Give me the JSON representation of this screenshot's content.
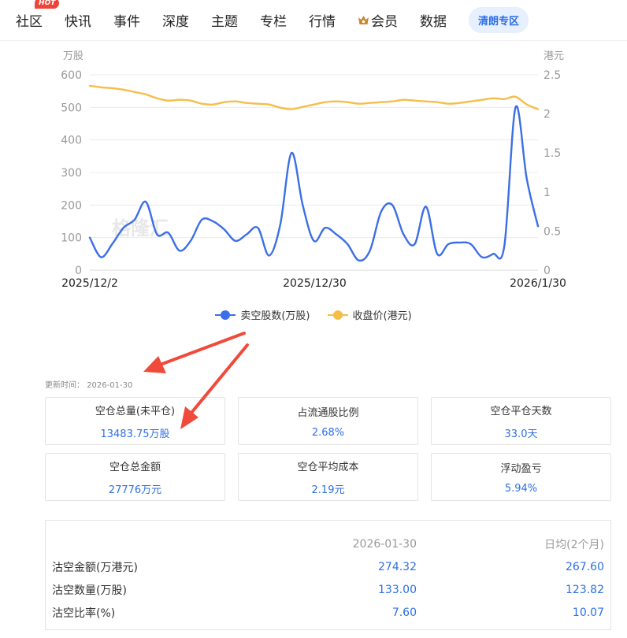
{
  "nav": {
    "items": [
      "社区",
      "快讯",
      "事件",
      "深度",
      "主题",
      "专栏",
      "行情",
      "会员",
      "数据"
    ],
    "hot_badge": "HOT",
    "special": "清朗专区"
  },
  "watermark": "格隆汇",
  "colors": {
    "short_volume": "#3b6fe6",
    "close_price": "#f5be4b",
    "value_blue": "#2d6fe5"
  },
  "legend": [
    "卖空股数(万股)",
    "收盘价(港元)"
  ],
  "chart_data": {
    "type": "line",
    "x_tick_labels": [
      "2025/12/2",
      "2025/12/30",
      "2026/1/30"
    ],
    "y_left": {
      "label": "万股",
      "range": [
        0,
        600
      ],
      "ticks": [
        0,
        100,
        200,
        300,
        400,
        500,
        600
      ]
    },
    "y_right": {
      "label": "港元",
      "range": [
        0,
        2.5
      ],
      "ticks": [
        0,
        0.5,
        1,
        1.5,
        2,
        2.5
      ]
    },
    "grid": true,
    "legend_position": "bottom",
    "series": [
      {
        "name": "卖空股数(万股)",
        "axis": "left",
        "values": [
          100,
          40,
          80,
          130,
          155,
          210,
          110,
          115,
          60,
          90,
          155,
          150,
          125,
          90,
          110,
          130,
          45,
          140,
          360,
          200,
          90,
          130,
          110,
          80,
          30,
          60,
          180,
          200,
          110,
          80,
          195,
          50,
          80,
          85,
          80,
          40,
          50,
          75,
          500,
          280,
          135
        ]
      },
      {
        "name": "收盘价(港元)",
        "axis": "right",
        "values": [
          2.36,
          2.34,
          2.33,
          2.31,
          2.28,
          2.25,
          2.2,
          2.17,
          2.18,
          2.17,
          2.13,
          2.12,
          2.15,
          2.16,
          2.14,
          2.13,
          2.12,
          2.08,
          2.06,
          2.09,
          2.12,
          2.15,
          2.16,
          2.15,
          2.13,
          2.14,
          2.15,
          2.16,
          2.18,
          2.17,
          2.16,
          2.15,
          2.13,
          2.14,
          2.16,
          2.18,
          2.2,
          2.19,
          2.22,
          2.12,
          2.06
        ]
      }
    ]
  },
  "update": {
    "label": "更新时间：",
    "value": "2026-01-30"
  },
  "cards": [
    {
      "label": "空仓总量(未平仓)",
      "value": "13483.75万股"
    },
    {
      "label": "占流通股比例",
      "value": "2.68%"
    },
    {
      "label": "空仓平仓天数",
      "value": "33.0天"
    },
    {
      "label": "空仓总金额",
      "value": "27776万元"
    },
    {
      "label": "空仓平均成本",
      "value": "2.19元"
    },
    {
      "label": "浮动盈亏",
      "value": "5.94%"
    }
  ],
  "table": {
    "headers": [
      "",
      "2026-01-30",
      "日均(2个月)"
    ],
    "rows": [
      [
        "沽空金额(万港元)",
        "274.32",
        "267.60"
      ],
      [
        "沽空数量(万股)",
        "133.00",
        "123.82"
      ],
      [
        "沽空比率(%)",
        "7.60",
        "10.07"
      ]
    ]
  }
}
